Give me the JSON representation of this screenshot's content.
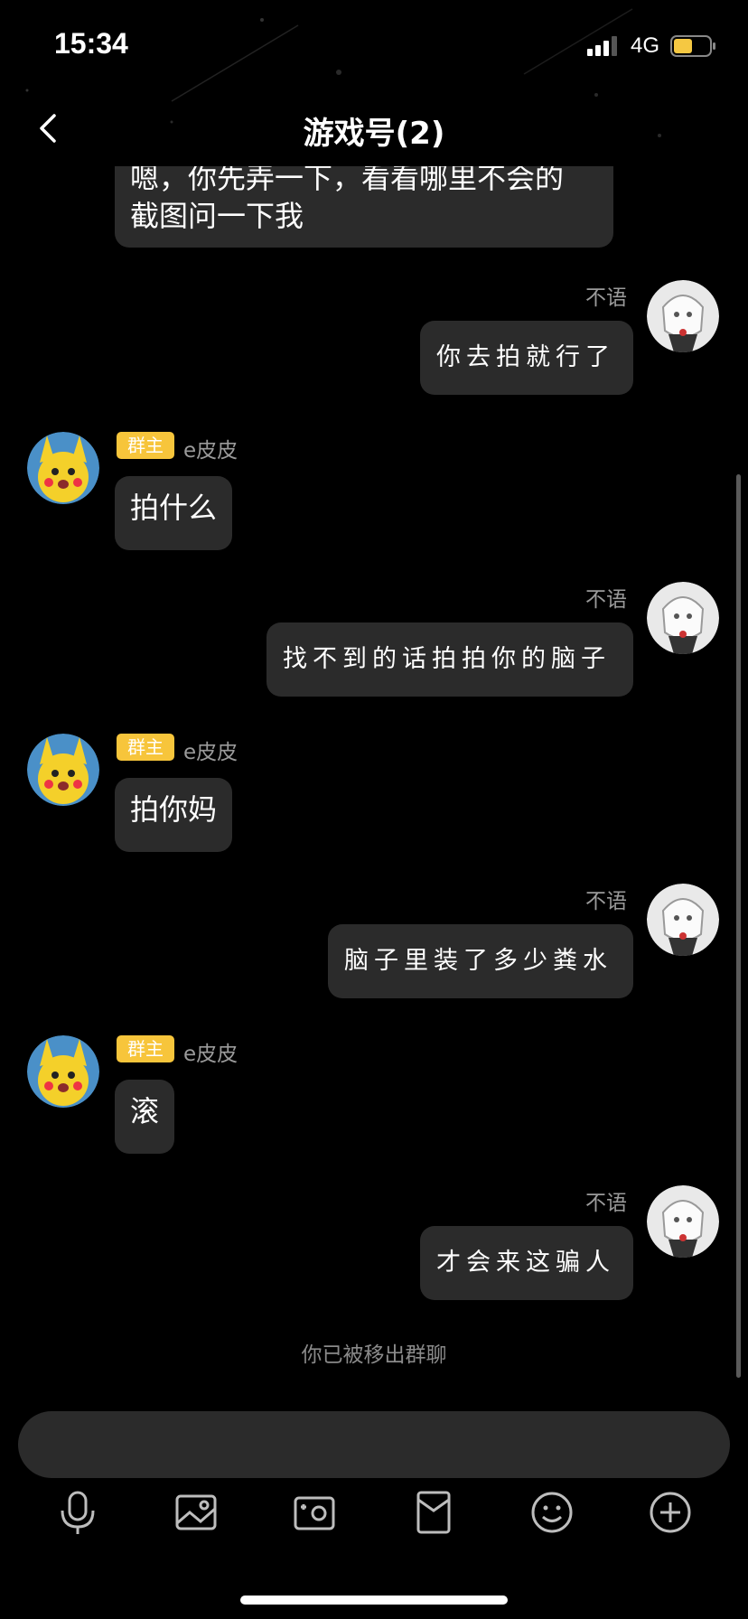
{
  "status": {
    "time": "15:34",
    "network": "4G"
  },
  "header": {
    "title": "游戏号(2)"
  },
  "messages": [
    {
      "side": "left",
      "text_lines": [
        "嗯，你先弄一下，看看哪里不会的",
        "截图问一下我"
      ]
    },
    {
      "side": "right",
      "sender": "不语",
      "text": "你去拍就行了"
    },
    {
      "side": "left",
      "badge": "群主",
      "sender": "e皮皮",
      "text": "拍什么"
    },
    {
      "side": "right",
      "sender": "不语",
      "text": "找不到的话拍拍你的脑子"
    },
    {
      "side": "left",
      "badge": "群主",
      "sender": "e皮皮",
      "text": "拍你妈"
    },
    {
      "side": "right",
      "sender": "不语",
      "text": "脑子里装了多少粪水"
    },
    {
      "side": "left",
      "badge": "群主",
      "sender": "e皮皮",
      "text": "滚"
    },
    {
      "side": "right",
      "sender": "不语",
      "text": "才会来这骗人"
    }
  ],
  "system_message": "你已被移出群聊",
  "toolbar": {
    "icons": [
      "microphone-icon",
      "image-icon",
      "camera-icon",
      "red-packet-icon",
      "emoji-icon",
      "add-icon"
    ]
  },
  "colors": {
    "background": "#000000",
    "bubble": "#2b2b2b",
    "badge": "#f7c53b",
    "battery": "#f5c842"
  }
}
